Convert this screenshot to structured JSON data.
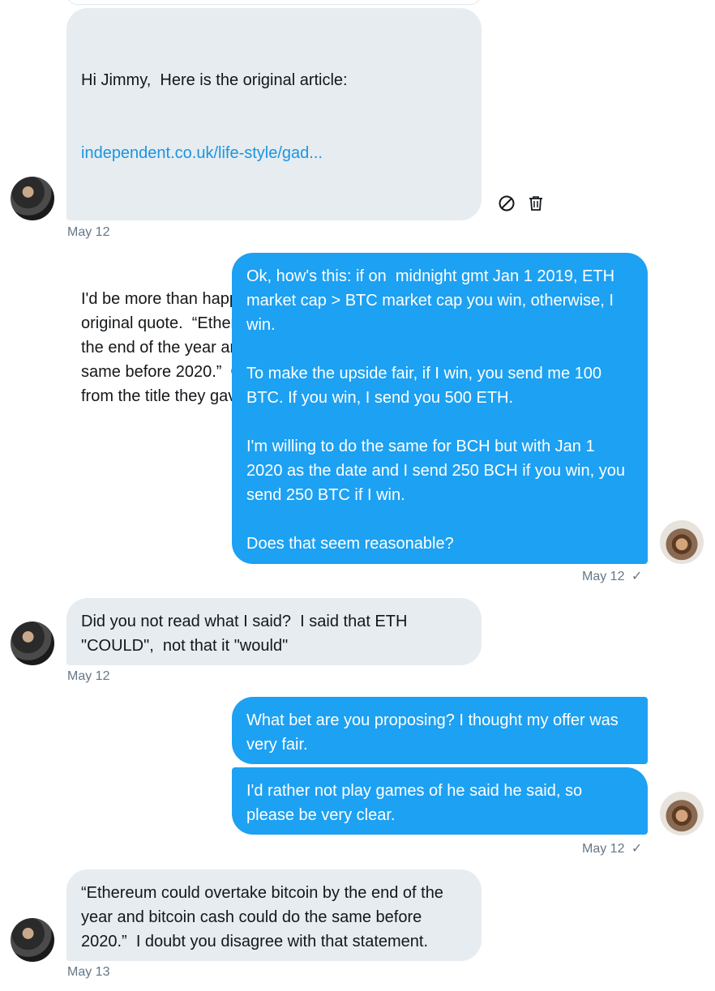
{
  "conversation": {
    "messages": [
      {
        "sender": "other",
        "paragraphs": [
          "Hi Jimmy,  Here is the original article:",
          "I'd be more than happy to take a bet regarding my original quote.  “Ethereum could overtake bitcoin by the end of the year and bitcoin cash could do the same before 2020.”  Obviously that is very different from the title they gave the article."
        ],
        "link": "independent.co.uk/life-style/gad...",
        "timestamp": "May 12"
      },
      {
        "sender": "me",
        "text": "Ok, how's this: if on  midnight gmt Jan 1 2019, ETH market cap > BTC market cap you win, otherwise, I win.\n\nTo make the upside fair, if I win, you send me 100 BTC. If you win, I send you 500 ETH.\n\nI'm willing to do the same for BCH but with Jan 1 2020 as the date and I send 250 BCH if you win, you send 250 BTC if I win.\n\nDoes that seem reasonable?",
        "timestamp": "May 12",
        "read_mark": "✓"
      },
      {
        "sender": "other",
        "text": "Did you not read what I said?  I said that ETH \"COULD\",  not that it \"would\"",
        "timestamp": "May 12"
      },
      {
        "sender": "me",
        "text": "What bet are you proposing? I thought my offer was very fair.",
        "grouped_with_next": true
      },
      {
        "sender": "me",
        "text": "I'd rather not play games of he said he said, so please be very clear.",
        "timestamp": "May 12",
        "read_mark": "✓"
      },
      {
        "sender": "other",
        "text": "“Ethereum could overtake bitcoin by the end of the year and bitcoin cash could do the same before 2020.”  I doubt you disagree with that statement.",
        "timestamp": "May 13"
      }
    ]
  },
  "icons": {
    "report": "report-icon",
    "delete": "trash-icon"
  },
  "colors": {
    "sent_bubble": "#1da1f2",
    "received_bubble": "#e6ecf0",
    "link": "#1b95e0",
    "timestamp": "#657786"
  }
}
